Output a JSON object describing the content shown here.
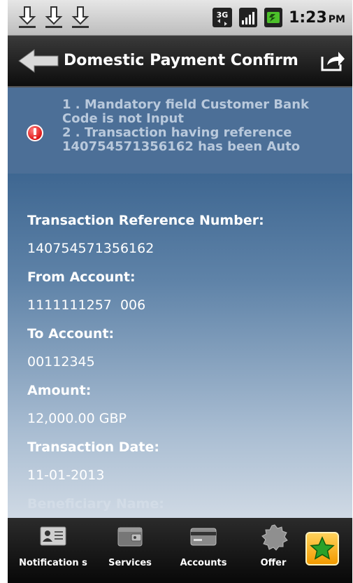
{
  "statusbar": {
    "time": "1:23",
    "ampm": "PM",
    "network": "3G",
    "icons": [
      "download-icon",
      "download-icon",
      "download-icon",
      "3g-icon",
      "signal-icon",
      "battery-icon"
    ]
  },
  "titlebar": {
    "title": "Domestic Payment Confirm",
    "back_icon": "back-arrow-icon",
    "share_icon": "share-icon"
  },
  "error": {
    "icon": "error-icon",
    "lines": [
      "1 . Mandatory field Customer Bank",
      "Code is not Input",
      "2 . Transaction having reference",
      "140754571356162 has been Auto"
    ]
  },
  "fields": [
    {
      "label": "Transaction Reference Number:",
      "value": "140754571356162"
    },
    {
      "label": "From Account:",
      "value": "1111111257  006"
    },
    {
      "label": "To Account:",
      "value": "00112345"
    },
    {
      "label": "Amount:",
      "value": "12,000.00 GBP"
    },
    {
      "label": "Transaction Date:",
      "value": "11-01-2013"
    },
    {
      "label": "Beneficiary Name:",
      "value": ""
    }
  ],
  "nav": {
    "items": [
      {
        "label": "Notification s",
        "icon": "contact-card-icon"
      },
      {
        "label": "Services",
        "icon": "wallet-icon"
      },
      {
        "label": "Accounts",
        "icon": "credit-card-icon"
      },
      {
        "label": "Offer",
        "icon": "badge-icon"
      }
    ],
    "favorite_icon": "star-icon"
  },
  "colors": {
    "content_top": "#24507f",
    "error_bg": "#4c6f97",
    "error_text": "#b9c9dc",
    "error_icon": "#e01818",
    "favorite": "#f29a00"
  }
}
